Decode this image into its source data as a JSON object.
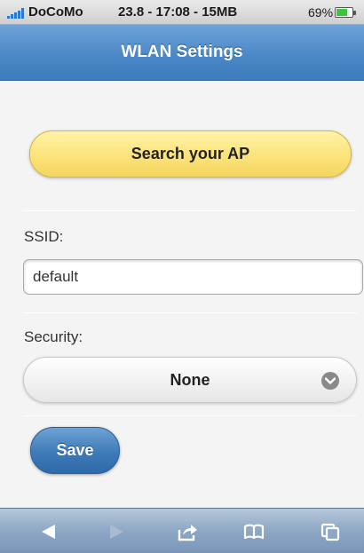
{
  "status_bar": {
    "carrier": "DoCoMo",
    "center_info": "23.8 - 17:08 - 15MB",
    "battery": "69%",
    "battery_level": 0.69
  },
  "header": {
    "title": "WLAN Settings"
  },
  "main": {
    "search_button": "Search your AP",
    "ssid_label": "SSID:",
    "ssid_value": "default",
    "security_label": "Security:",
    "security_value": "None",
    "save_button": "Save"
  },
  "toolbar": {
    "icons": [
      "back-arrow-icon",
      "forward-arrow-icon",
      "share-icon",
      "bookmarks-icon",
      "tabs-icon"
    ]
  },
  "colors": {
    "header": "#4c88c6",
    "search_button": "#fbe37a",
    "save_button": "#3f7ab8",
    "toolbar": "#8ea7c5"
  }
}
